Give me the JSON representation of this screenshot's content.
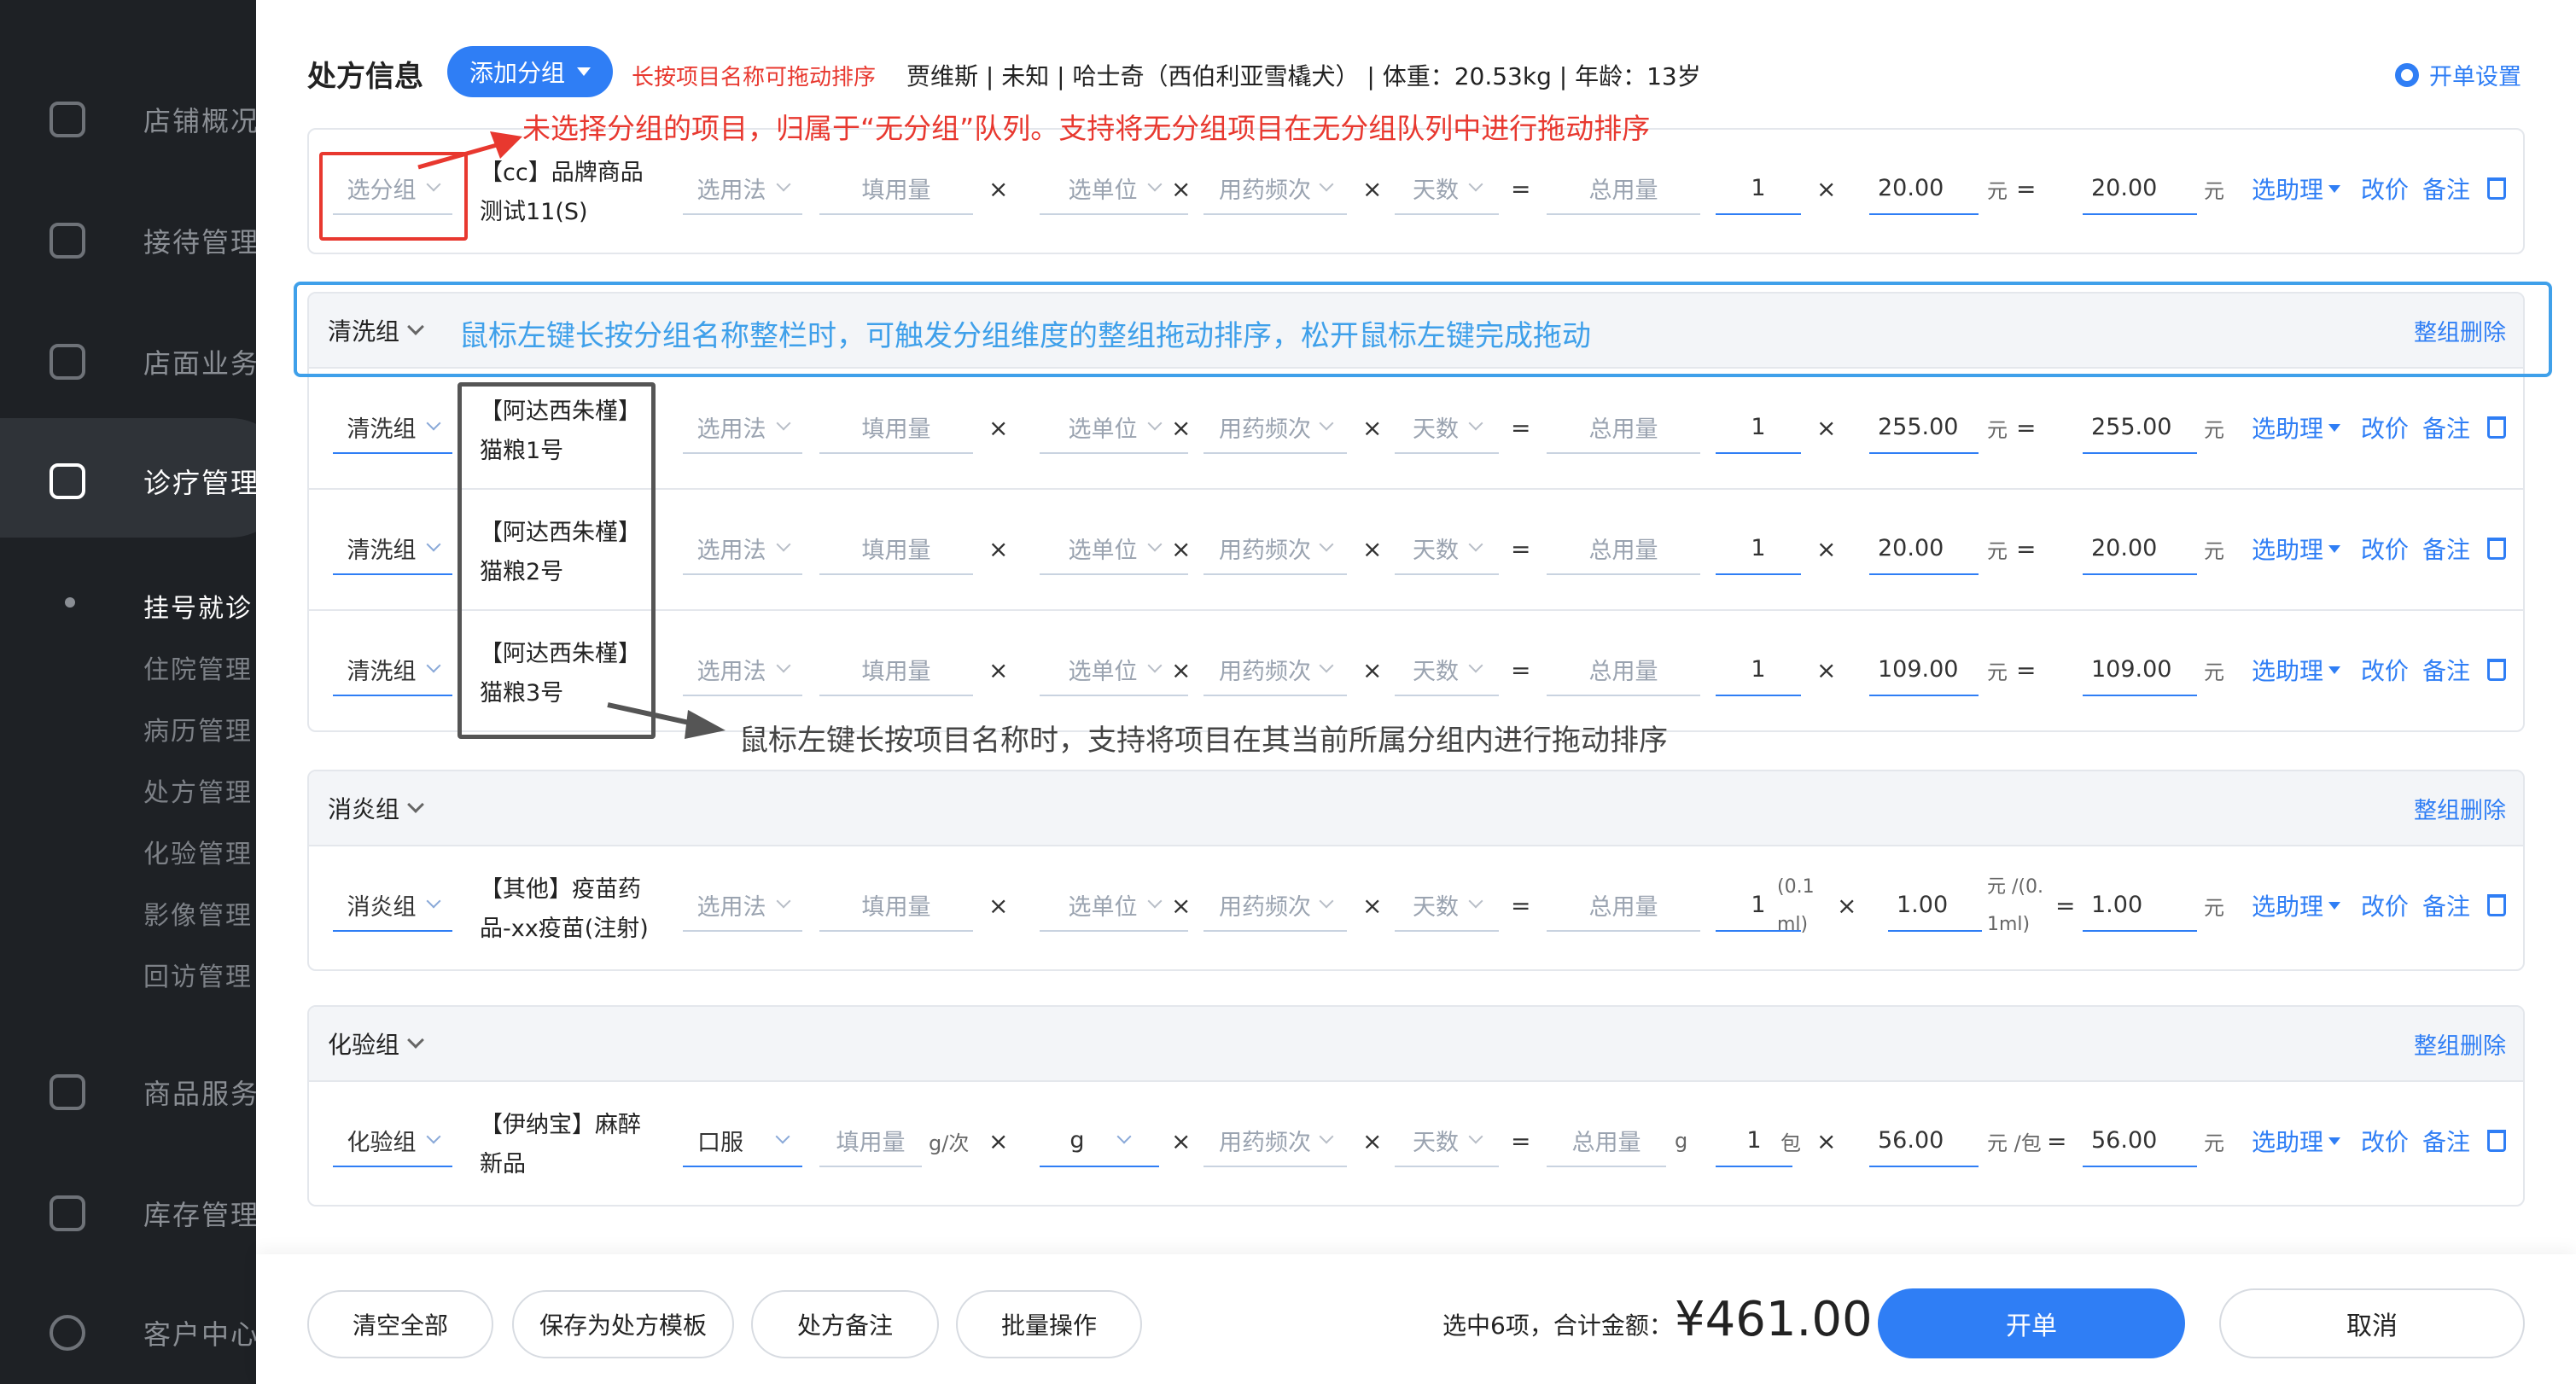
{
  "sidebar": {
    "items": [
      {
        "label": "店铺概况",
        "icon": "monitor-icon"
      },
      {
        "label": "接待管理",
        "icon": "clipboard-icon"
      },
      {
        "label": "店面业务",
        "icon": "house-icon"
      },
      {
        "label": "诊疗管理",
        "icon": "medical-kit-icon"
      },
      {
        "label": "商品服务",
        "icon": "bag-icon"
      },
      {
        "label": "库存管理",
        "icon": "box-icon"
      },
      {
        "label": "客户中心",
        "icon": "user-icon"
      }
    ],
    "sub_items": [
      "挂号就诊",
      "住院管理",
      "病历管理",
      "处方管理",
      "化验管理",
      "影像管理",
      "回访管理"
    ]
  },
  "header": {
    "title": "处方信息",
    "add_group_label": "添加分组",
    "hint": "长按项目名称可拖动排序",
    "patient_info": "贾维斯 | 未知 | 哈士奇（西伯利亚雪橇犬） | 体重：20.53kg | 年龄：13岁",
    "settings_label": "开单设置"
  },
  "labels": {
    "select_method": "选用法",
    "fill_dose": "填用量",
    "select_unit": "选单位",
    "frequency": "用药频次",
    "days": "天数",
    "total": "总用量",
    "select_assistant": "选助理",
    "change_price": "改价",
    "remark": "备注",
    "times": "×",
    "equals": "=",
    "yuan": "元",
    "delete_group": "整组删除",
    "select_group": "选分组"
  },
  "ungrouped": {
    "items": [
      {
        "name_line1": "【cc】品牌商品",
        "name_line2": "测试11(S)",
        "qty": "1",
        "price": "20.00",
        "subtotal": "20.00"
      }
    ]
  },
  "groups": [
    {
      "name": "清洗组",
      "items": [
        {
          "group": "清洗组",
          "name_line1": "【阿达西朱槿】",
          "name_line2": "猫粮1号",
          "qty": "1",
          "price": "255.00",
          "subtotal": "255.00"
        },
        {
          "group": "清洗组",
          "name_line1": "【阿达西朱槿】",
          "name_line2": "猫粮2号",
          "qty": "1",
          "price": "20.00",
          "subtotal": "20.00"
        },
        {
          "group": "清洗组",
          "name_line1": "【阿达西朱槿】",
          "name_line2": "猫粮3号",
          "qty": "1",
          "price": "109.00",
          "subtotal": "109.00"
        }
      ]
    },
    {
      "name": "消炎组",
      "items": [
        {
          "group": "消炎组",
          "name_line1": "【其他】疫苗药",
          "name_line2": "品-xx疫苗(注射)",
          "qty": "1",
          "qty_unit_top": "(0.1",
          "qty_unit_bottom": "ml)",
          "price": "1.00",
          "price_unit_top": "元 /(0.",
          "price_unit_bottom": "1ml)",
          "subtotal": "1.00"
        }
      ]
    },
    {
      "name": "化验组",
      "items": [
        {
          "group": "化验组",
          "name_line1": "【伊纳宝】麻醉",
          "name_line2": "新品",
          "method": "口服",
          "dose_unit": "g/次",
          "unit": "g",
          "total_unit": "g",
          "qty": "1",
          "qty_unit": "包",
          "price": "56.00",
          "price_unit": "元 /包",
          "subtotal": "56.00"
        }
      ]
    }
  ],
  "annotations": {
    "red": "未选择分组的项目，归属于“无分组”队列。支持将无分组项目在无分组队列中进行拖动排序",
    "blue": "鼠标左键长按分组名称整栏时，可触发分组维度的整组拖动排序，松开鼠标左键完成拖动",
    "gray": "鼠标左键长按项目名称时，支持将项目在其当前所属分组内进行拖动排序"
  },
  "footer": {
    "clear_all": "清空全部",
    "save_template": "保存为处方模板",
    "rx_remark": "处方备注",
    "batch": "批量操作",
    "summary": "选中6项，合计金额：",
    "total": "¥461.00",
    "submit": "开单",
    "cancel": "取消"
  },
  "colors": {
    "primary": "#2f7ef5",
    "sidebar_bg": "#1e2125",
    "annotation_red": "#e8382f",
    "annotation_blue": "#3fa0ea",
    "annotation_gray": "#555555"
  }
}
